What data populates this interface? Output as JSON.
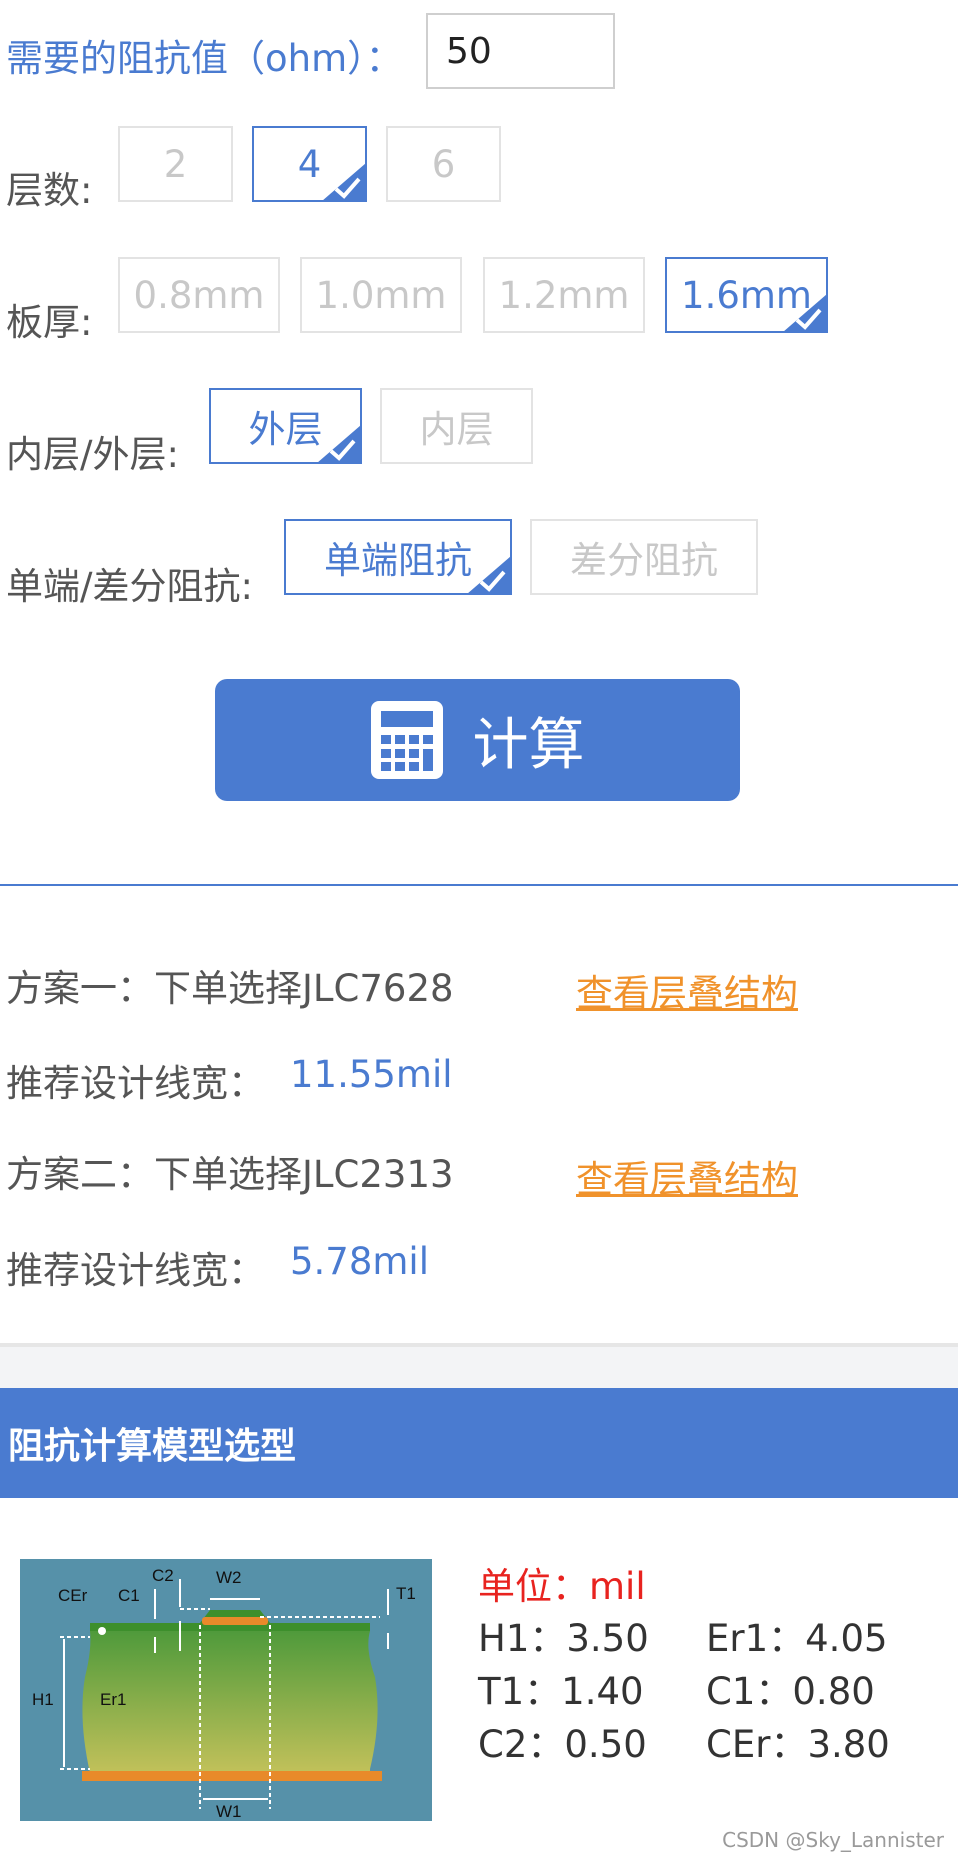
{
  "impedance": {
    "label": "需要的阻抗值（ohm）：",
    "value": "50"
  },
  "layers": {
    "label": "层数:",
    "options": [
      "2",
      "4",
      "6"
    ],
    "selected": "4"
  },
  "thickness": {
    "label": "板厚:",
    "options": [
      "0.8mm",
      "1.0mm",
      "1.2mm",
      "1.6mm"
    ],
    "selected": "1.6mm"
  },
  "layer_side": {
    "label": "内层/外层:",
    "options": [
      "外层",
      "内层"
    ],
    "selected": "外层"
  },
  "impedance_type": {
    "label": "单端/差分阻抗:",
    "options": [
      "单端阻抗",
      "差分阻抗"
    ],
    "selected": "单端阻抗"
  },
  "calc_button": {
    "label": "计算",
    "icon": "calculator-icon"
  },
  "results": [
    {
      "plan": "方案一：下单选择JLC7628",
      "link": "查看层叠结构",
      "width_label": "推荐设计线宽：",
      "width_value": "11.55mil"
    },
    {
      "plan": "方案二：下单选择JLC2313",
      "link": "查看层叠结构",
      "width_label": "推荐设计线宽：",
      "width_value": "5.78mil"
    }
  ],
  "model_section": {
    "title": "阻抗计算模型选型",
    "unit": "单位：mil",
    "params": [
      {
        "key": "H1",
        "value": "3.50"
      },
      {
        "key": "Er1",
        "value": "4.05"
      },
      {
        "key": "T1",
        "value": "1.40"
      },
      {
        "key": "C1",
        "value": "0.80"
      },
      {
        "key": "C2",
        "value": "0.50"
      },
      {
        "key": "CEr",
        "value": "3.80"
      }
    ],
    "diagram_labels": [
      "CEr",
      "C1",
      "C2",
      "W2",
      "T1",
      "H1",
      "Er1",
      "W1"
    ]
  },
  "watermark": "CSDN @Sky_Lannister",
  "colors": {
    "accent": "#4a7bd0",
    "link": "#f0922b",
    "unit": "#e8231f"
  }
}
